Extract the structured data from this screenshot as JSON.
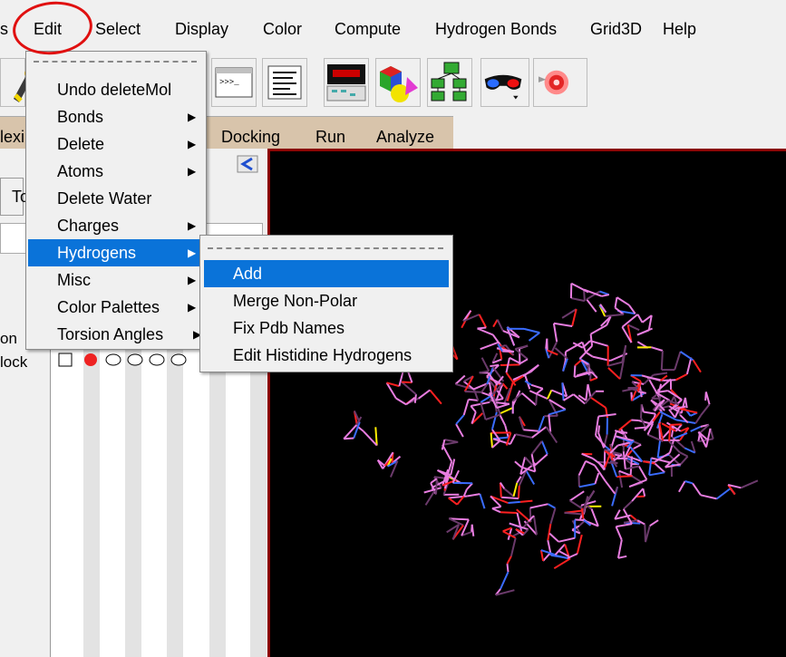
{
  "menubar": {
    "items": [
      "s",
      "Edit",
      "Select",
      "Display",
      "Color",
      "Compute",
      "Hydrogen Bonds",
      "Grid3D",
      "Help"
    ]
  },
  "toolbar": {
    "icons": [
      "brush-icon",
      "python-shell-icon",
      "text-lines-icon",
      "dashboard-icon",
      "shapes-icon",
      "network-icon",
      "stereo-glasses-icon",
      "lighting-icon"
    ]
  },
  "tabs": {
    "items": [
      "lexi",
      "Docking",
      "Run",
      "Analyze"
    ]
  },
  "left_panel": {
    "button_fragment": "To",
    "label_fragments": [
      "on",
      "lock"
    ],
    "back_arrow": "<"
  },
  "edit_menu": {
    "items": [
      {
        "label": "Undo deleteMol",
        "submenu": false
      },
      {
        "label": "Bonds",
        "submenu": true
      },
      {
        "label": "Delete",
        "submenu": true
      },
      {
        "label": "Atoms",
        "submenu": true
      },
      {
        "label": "Delete Water",
        "submenu": false
      },
      {
        "label": "Charges",
        "submenu": true
      },
      {
        "label": "Hydrogens",
        "submenu": true,
        "selected": true
      },
      {
        "label": "Misc",
        "submenu": true
      },
      {
        "label": "Color Palettes",
        "submenu": true
      },
      {
        "label": "Torsion Angles",
        "submenu": true
      }
    ],
    "arrow": "▶"
  },
  "hydrogens_submenu": {
    "items": [
      {
        "label": "Add",
        "selected": true
      },
      {
        "label": "Merge Non-Polar"
      },
      {
        "label": "Fix Pdb Names"
      },
      {
        "label": "Edit Histidine Hydrogens"
      }
    ]
  },
  "viewer": {
    "background": "#000000",
    "colors": {
      "carbon": "#e87de0",
      "dark": "#6b3a6b",
      "nitrogen": "#3a6cff",
      "oxygen": "#ff2020",
      "sulfur": "#ffee00"
    }
  },
  "colors": {
    "selection": "#0a73d9",
    "annotation": "#e01010",
    "tab_strip": "#d8c4ab"
  }
}
